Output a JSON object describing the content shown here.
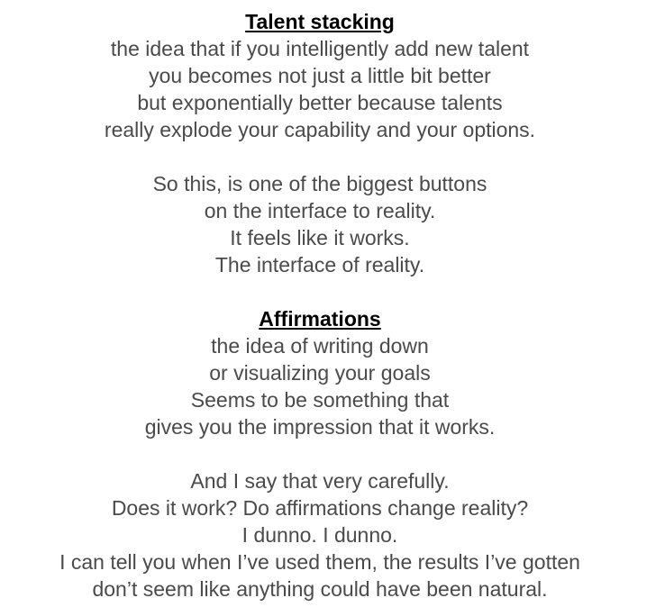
{
  "sections": [
    {
      "heading": "Talent stacking",
      "paragraph1": [
        "the idea that if you intelligently add new talent",
        "you becomes not just a little bit better",
        "but exponentially better because talents",
        "really explode your capability and your options."
      ],
      "paragraph2": [
        "So this, is one of the biggest buttons",
        "on the interface to reality.",
        "It feels like it works.",
        "The interface of reality."
      ]
    },
    {
      "heading": "Affirmations",
      "paragraph1": [
        "the idea of writing down",
        "or visualizing your goals",
        "Seems to be something that",
        "gives you the impression that it works."
      ],
      "paragraph2": [
        "And I say that very carefully.",
        "Does it work? Do affirmations change reality?",
        "I dunno. I dunno.",
        "I can tell you when I’ve used them, the results I’ve gotten",
        "don’t seem like anything could have been natural."
      ]
    }
  ]
}
